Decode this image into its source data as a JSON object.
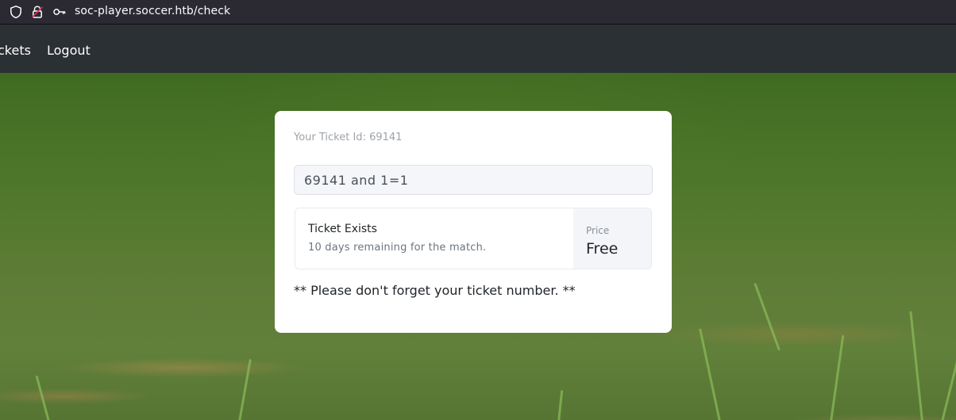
{
  "browser": {
    "url": "soc-player.soccer.htb/check",
    "icons": [
      "shield-icon",
      "insecure-lock-icon",
      "key-icon"
    ]
  },
  "navbar": {
    "links": [
      {
        "label": "ckets"
      },
      {
        "label": "Logout"
      }
    ],
    "background": "#2b3035"
  },
  "card": {
    "ticket_id_text": "Your Ticket Id: 69141",
    "input_value": "69141 and 1=1",
    "result": {
      "status": "Ticket Exists",
      "detail": "10 days remaining for the match.",
      "price_label": "Price",
      "price_value": "Free"
    },
    "reminder": "** Please don't forget your ticket number. **"
  },
  "colors": {
    "urlbar_bg": "#2b2a33",
    "card_bg": "#ffffff",
    "insecure_lock_accent": "#e22850"
  }
}
